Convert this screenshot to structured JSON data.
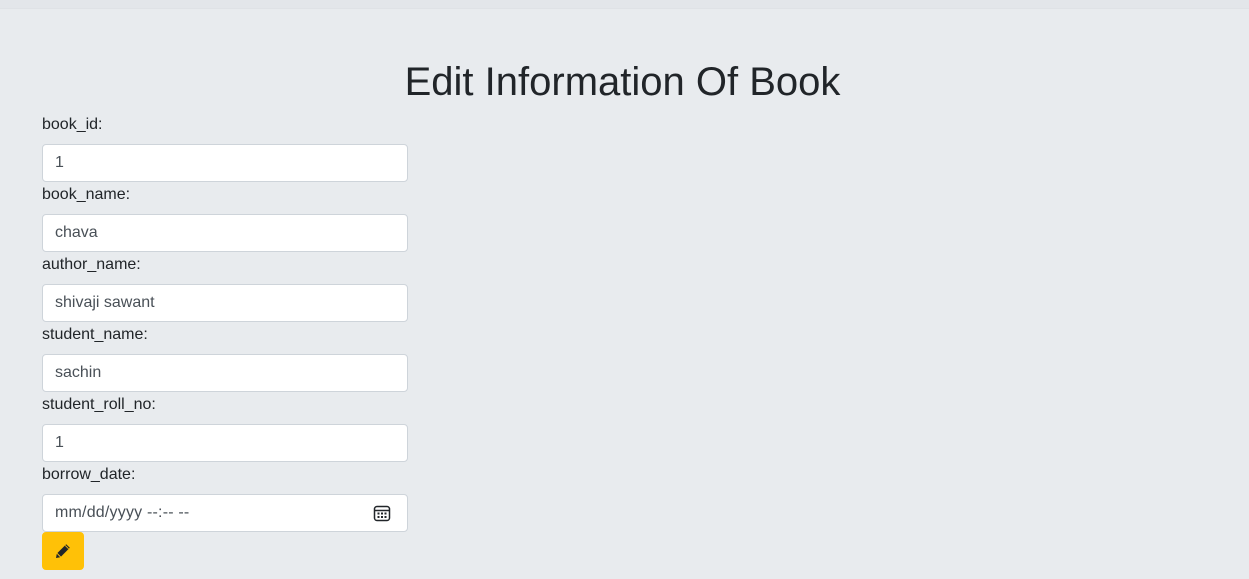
{
  "page": {
    "title": "Edit Information Of Book"
  },
  "form": {
    "fields": [
      {
        "label": "book_id:",
        "value": "1"
      },
      {
        "label": "book_name:",
        "value": "chava"
      },
      {
        "label": "author_name:",
        "value": "shivaji sawant"
      },
      {
        "label": "student_name:",
        "value": "sachin"
      },
      {
        "label": "student_roll_no:",
        "value": "1"
      },
      {
        "label": "borrow_date:",
        "placeholder": "mm/dd/yyyy  --:--  --"
      }
    ],
    "submit_icon": "pencil-icon"
  },
  "colors": {
    "background": "#e8ebee",
    "button": "#ffc107",
    "input_border": "#ced4da"
  }
}
